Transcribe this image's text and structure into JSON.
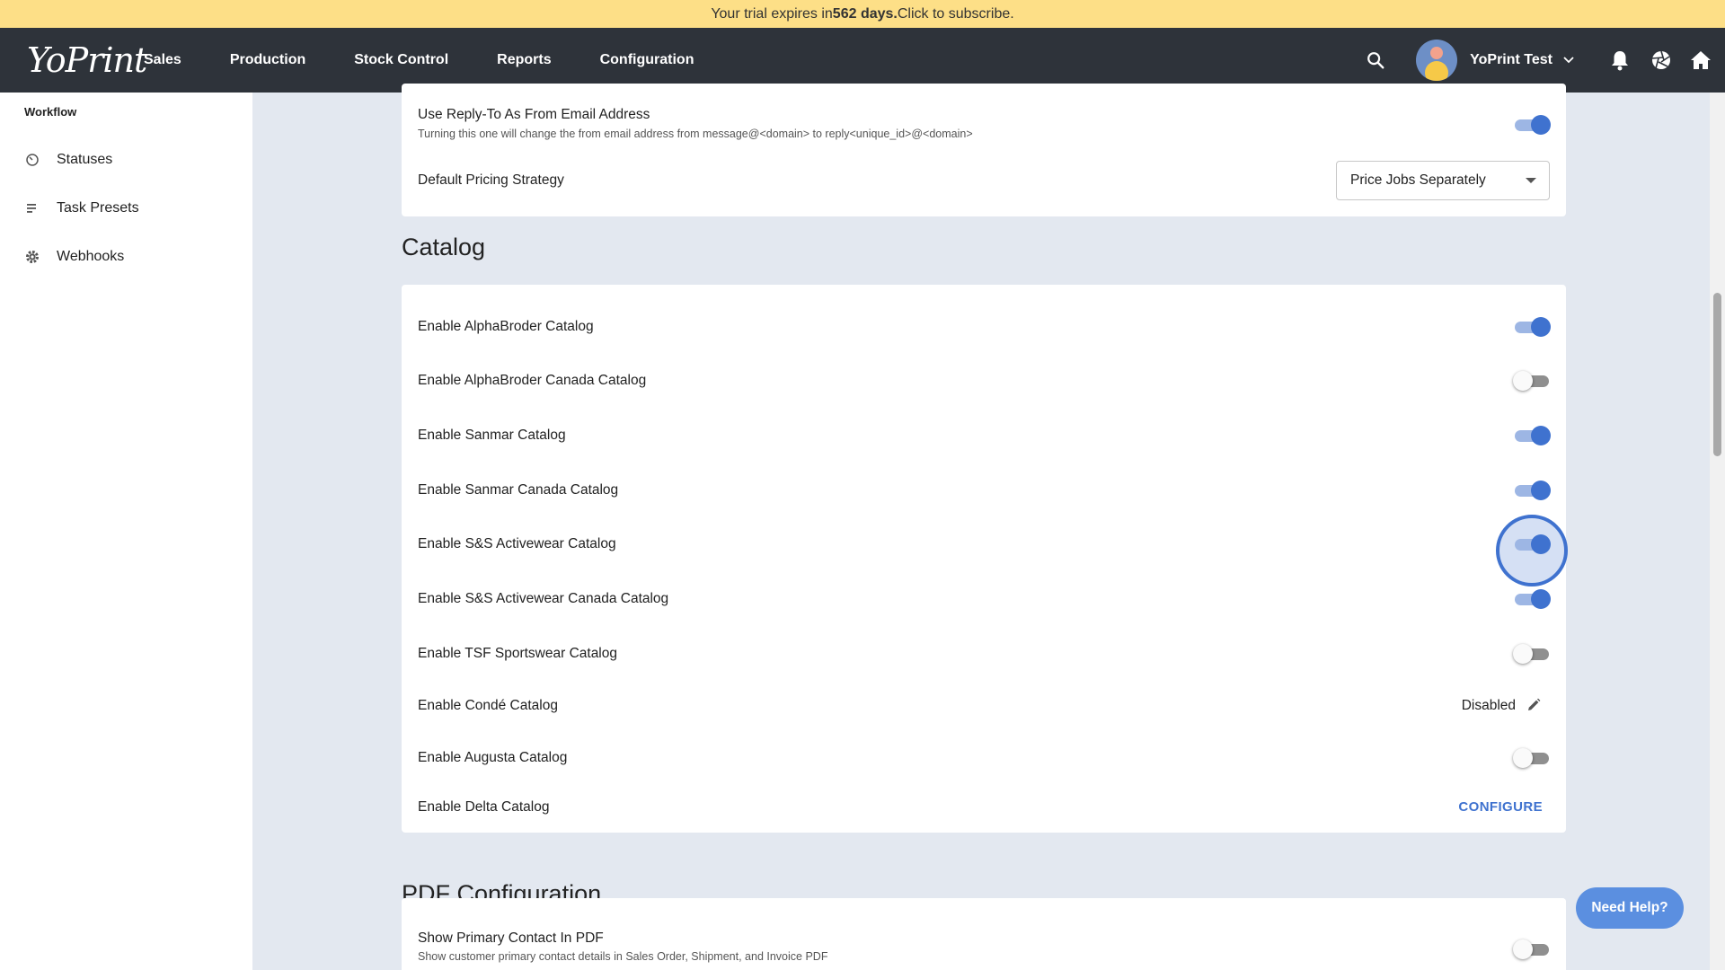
{
  "banner": {
    "prefix": "Your trial expires in ",
    "days": "562 days.",
    "suffix": " Click to subscribe."
  },
  "nav": {
    "logo": "YoPrint",
    "items": [
      "Sales",
      "Production",
      "Stock Control",
      "Reports",
      "Configuration"
    ],
    "user_name": "YoPrint Test",
    "icons": [
      "search-icon",
      "chevron-down-icon",
      "bell-icon",
      "aperture-icon",
      "home-icon"
    ]
  },
  "sidebar": {
    "heading": "Workflow",
    "items": [
      {
        "label": "Statuses",
        "icon": "timer-icon"
      },
      {
        "label": "Task Presets",
        "icon": "list-icon"
      },
      {
        "label": "Webhooks",
        "icon": "gear-icon"
      }
    ]
  },
  "email_card": {
    "reply_to": {
      "label": "Use Reply-To As From Email Address",
      "description": "Turning this one will change the from email address from message@<domain> to reply<unique_id>@<domain>",
      "enabled": true
    },
    "pricing": {
      "label": "Default Pricing Strategy",
      "value": "Price Jobs Separately"
    }
  },
  "catalog": {
    "title": "Catalog",
    "rows": [
      {
        "label": "Enable AlphaBroder Catalog",
        "control": "toggle",
        "enabled": true
      },
      {
        "label": "Enable AlphaBroder Canada Catalog",
        "control": "toggle",
        "enabled": false
      },
      {
        "label": "Enable Sanmar Catalog",
        "control": "toggle",
        "enabled": true
      },
      {
        "label": "Enable Sanmar Canada Catalog",
        "control": "toggle",
        "enabled": true
      },
      {
        "label": "Enable S&S Activewear Catalog",
        "control": "toggle",
        "enabled": true,
        "focused": true
      },
      {
        "label": "Enable S&S Activewear Canada Catalog",
        "control": "toggle",
        "enabled": true
      },
      {
        "label": "Enable TSF Sportswear Catalog",
        "control": "toggle",
        "enabled": false
      },
      {
        "label": "Enable Condé Catalog",
        "control": "status",
        "status_text": "Disabled",
        "icon": "pencil-icon"
      },
      {
        "label": "Enable Augusta Catalog",
        "control": "toggle",
        "enabled": false
      },
      {
        "label": "Enable Delta Catalog",
        "control": "link",
        "link_text": "CONFIGURE"
      }
    ]
  },
  "pdf": {
    "title": "PDF Configuration",
    "rows": [
      {
        "label": "Show Primary Contact In PDF",
        "description": "Show customer primary contact details in Sales Order, Shipment, and Invoice PDF",
        "enabled": false
      }
    ]
  },
  "help_button": "Need Help?",
  "colors": {
    "accent": "#3f72cf",
    "banner": "#fddf87",
    "nav": "#2e333a"
  }
}
